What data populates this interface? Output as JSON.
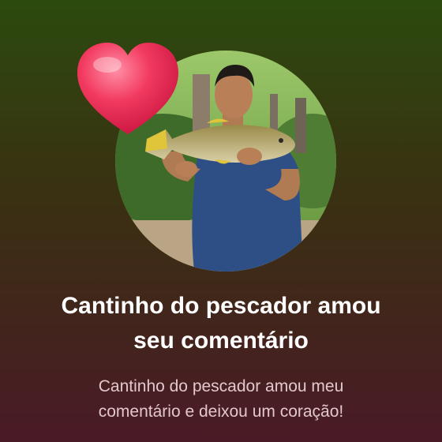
{
  "notification": {
    "title": "Cantinho do pescador  amou\nseu comentário",
    "message": "Cantinho do pescador  amou meu\ncomentário e deixou um coração!"
  },
  "icons": {
    "reaction": "heart-icon",
    "profile": "avatar-photo"
  },
  "colors": {
    "background_top": "#2c4a0e",
    "background_bottom": "#4a1a26",
    "heart": "#e8294f",
    "title_text": "#ffffff",
    "message_text": "#e2c8cc"
  }
}
